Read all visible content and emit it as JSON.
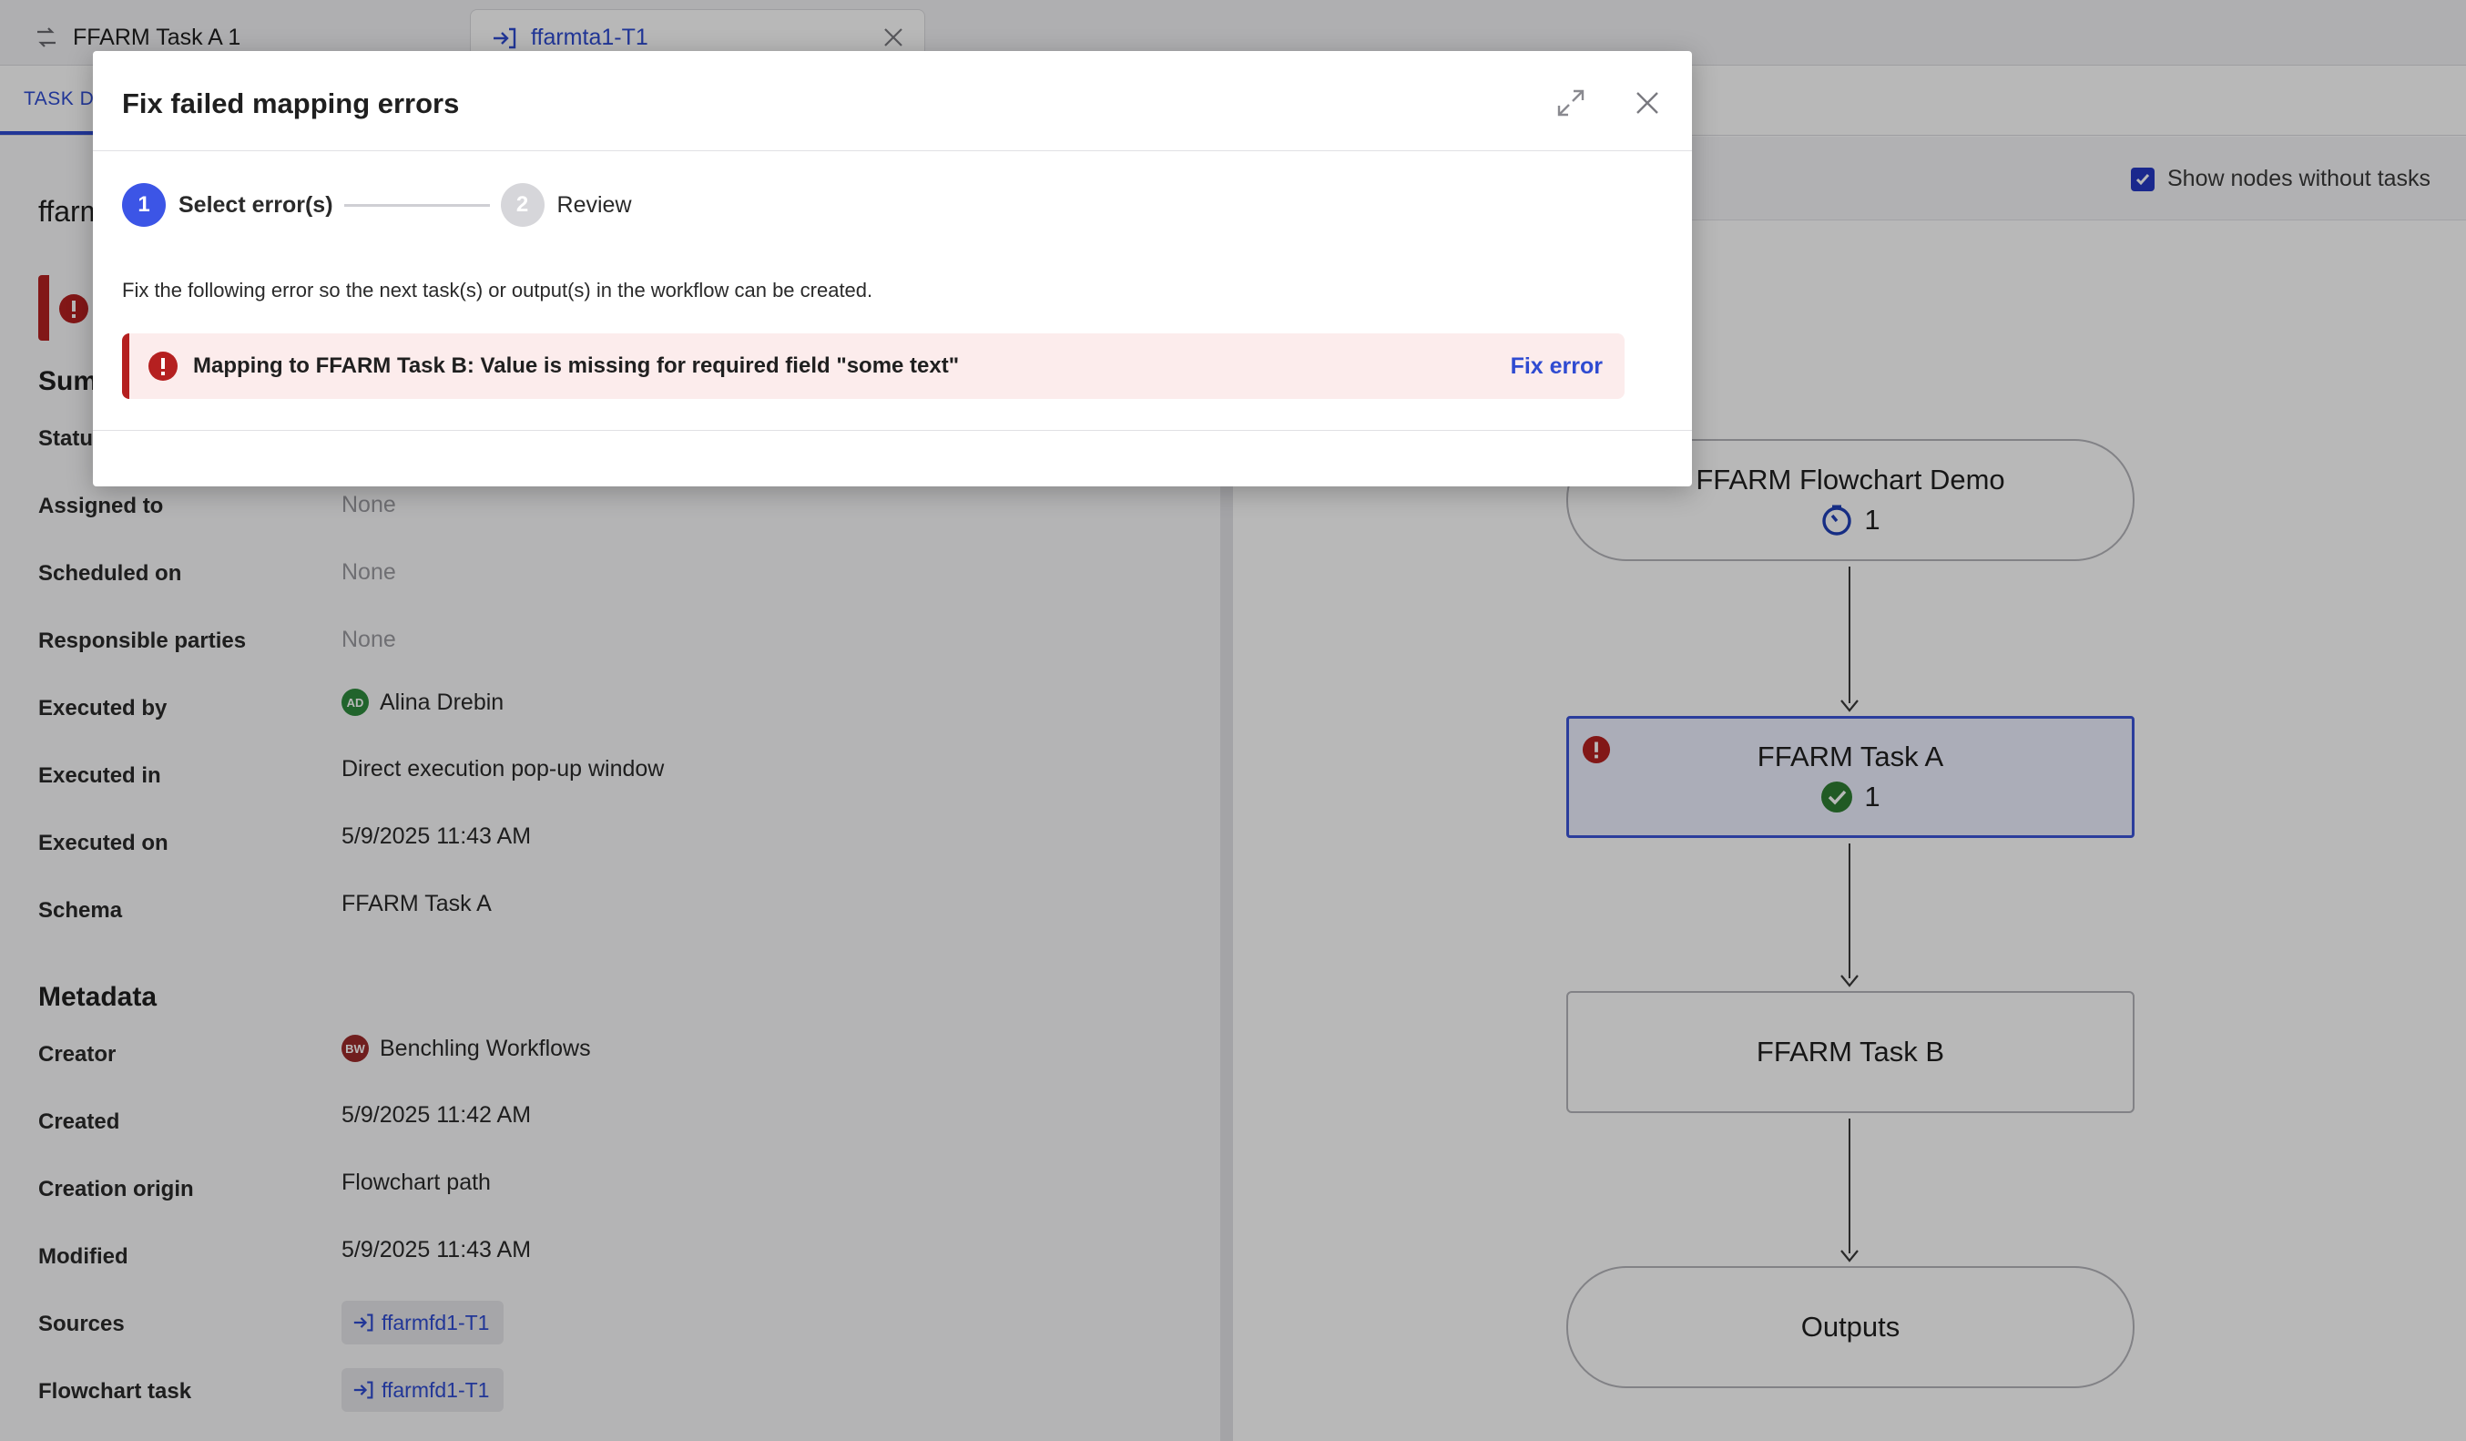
{
  "tabs": [
    {
      "label": "FFARM Task A 1",
      "icon": "workflow-icon"
    },
    {
      "label": "ffarmta1-T1",
      "icon": "task-entry-icon",
      "active": true
    }
  ],
  "subtab": {
    "label": "TASK DE"
  },
  "left": {
    "title": "ffarm",
    "summary_title": "Sum",
    "status_label": "Statu",
    "rows": [
      {
        "label": "Assigned to",
        "value": "None"
      },
      {
        "label": "Scheduled on",
        "value": "None"
      },
      {
        "label": "Responsible parties",
        "value": "None"
      },
      {
        "label": "Executed by",
        "value": "Alina Drebin",
        "avatar": "AD"
      },
      {
        "label": "Executed in",
        "value": "Direct execution pop-up window"
      },
      {
        "label": "Executed on",
        "value": "5/9/2025 11:43 AM"
      },
      {
        "label": "Schema",
        "value": "FFARM Task A"
      }
    ],
    "metadata_title": "Metadata",
    "meta_rows": [
      {
        "label": "Creator",
        "value": "Benchling Workflows",
        "avatar": "BW"
      },
      {
        "label": "Created",
        "value": "5/9/2025 11:42 AM"
      },
      {
        "label": "Creation origin",
        "value": "Flowchart path"
      },
      {
        "label": "Modified",
        "value": "5/9/2025 11:43 AM"
      },
      {
        "label": "Sources",
        "value": "ffarmfd1-T1"
      },
      {
        "label": "Flowchart task",
        "value": "ffarmfd1-T1"
      }
    ]
  },
  "right": {
    "show_nodes_label": "Show nodes without tasks",
    "show_nodes_checked": true,
    "nodes": [
      {
        "label": "FFARM Flowchart Demo",
        "count": "1",
        "status": "in-progress"
      },
      {
        "label": "FFARM Task A",
        "count": "1",
        "status": "complete",
        "error": true
      },
      {
        "label": "FFARM Task B"
      },
      {
        "label": "Outputs"
      }
    ]
  },
  "modal": {
    "title": "Fix failed mapping errors",
    "steps": [
      {
        "num": "1",
        "label": "Select error(s)"
      },
      {
        "num": "2",
        "label": "Review"
      }
    ],
    "instruction": "Fix the following error so the next task(s) or output(s) in the workflow can be created.",
    "error_text": "Mapping to FFARM Task B: Value is missing for required field \"some text\"",
    "fix_label": "Fix error"
  },
  "colors": {
    "accent": "#3c55e6",
    "link": "#2f4bd1",
    "error": "#b52020",
    "error_bg": "#fcecec",
    "success": "#2e7d32"
  }
}
